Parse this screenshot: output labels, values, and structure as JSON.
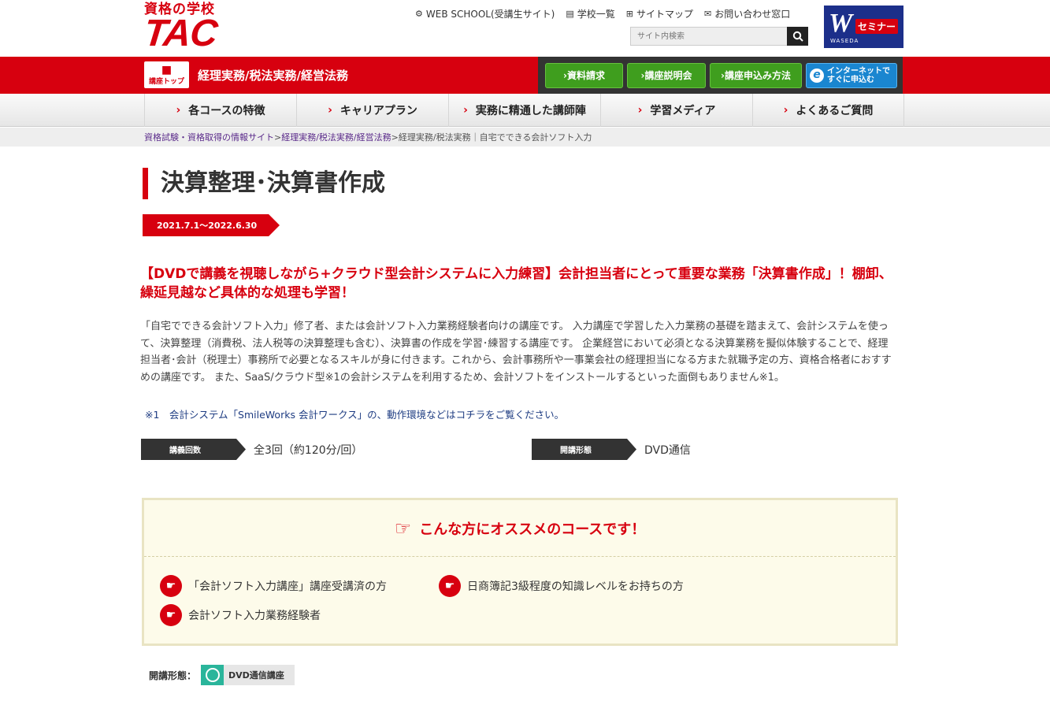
{
  "header": {
    "logo_tagline": "資格の学校",
    "logo_brand": "TAC",
    "utility_links": [
      {
        "icon": "gear-icon",
        "label": "WEB SCHOOL(受講生サイト)"
      },
      {
        "icon": "book-icon",
        "label": "学校一覧"
      },
      {
        "icon": "sitemap-icon",
        "label": "サイトマップ"
      },
      {
        "icon": "mail-icon",
        "label": "お問い合わせ窓口"
      }
    ],
    "search_placeholder": "サイト内検索",
    "partner": {
      "letter": "W",
      "name": "セミナー",
      "sub": "WASEDA"
    }
  },
  "redbar": {
    "course_top_label": "講座トップ",
    "title": "経理実務/税法実務/経営法務",
    "buttons": [
      "›資料請求",
      "›講座説明会",
      "›講座申込み方法"
    ],
    "internet_button": {
      "line1": "インターネットで",
      "line2": "すぐに申込む"
    }
  },
  "nav": {
    "items": [
      "各コースの特徴",
      "キャリアプラン",
      "実務に精通した講師陣",
      "学習メディア",
      "よくあるご質問"
    ]
  },
  "breadcrumb": {
    "links": [
      "資格試験・資格取得の情報サイト",
      "経理実務/税法実務/経営法務"
    ],
    "current": "経理実務/税法実務｜自宅でできる会計ソフト入力"
  },
  "main": {
    "title": "決算整理･決算書作成",
    "period": "2021.7.1～2022.6.30",
    "lead": "【DVDで講義を視聴しながら+クラウド型会計システムに入力練習】会計担当者にとって重要な業務「決算書作成」！棚卸、繰延見越など具体的な処理も学習！",
    "description": "「自宅でできる会計ソフト入力」修了者、または会計ソフト入力業務経験者向けの講座です。 入力講座で学習した入力業務の基礎を踏まえて、会計システムを使って、決算整理（消費税、法人税等の決算整理も含む）、決算書の作成を学習･練習する講座です。 企業経営において必須となる決算業務を擬似体験することで、経理担当者･会計（税理士）事務所で必要となるスキルが身に付きます。これから、会計事務所や一事業会社の経理担当になる方また就職予定の方、資格合格者におすすめの講座です。 また、SaaS/クラウド型※1の会計システムを利用するため、会計ソフトをインストールするといった面倒もありません※1。",
    "note": "※1　会計システム「SmileWorks 会計ワークス」の、動作環境などはコチラをご覧ください。",
    "specs": [
      {
        "tag": "講義回数",
        "value": "全3回（約120分/回）"
      },
      {
        "tag": "開講形態",
        "value": "DVD通信"
      }
    ]
  },
  "recommend": {
    "heading": "こんな方にオススメのコースです！",
    "items": [
      "「会計ソフト入力講座」講座受講済の方",
      "日商簿記3級程度の知識レベルをお持ちの方",
      "会計ソフト入力業務経験者"
    ]
  },
  "mode": {
    "label": "開講形態：",
    "badge": "DVD通信講座"
  },
  "colors": {
    "brand_red": "#d7000f",
    "button_green": "#3f9e1e",
    "internet_blue": "#1a86d0"
  }
}
